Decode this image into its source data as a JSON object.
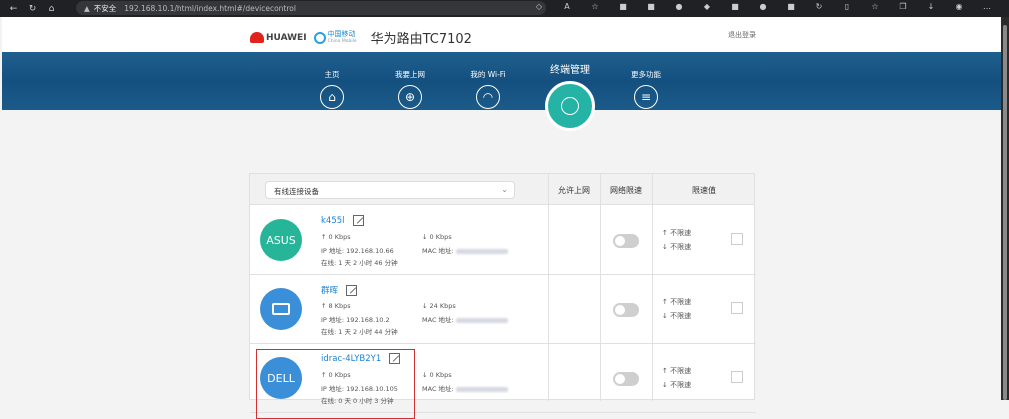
{
  "browser": {
    "security_label": "不安全",
    "url": "192.168.10.1/html/index.html#/devicecontrol"
  },
  "header": {
    "brand_huawei": "HUAWEI",
    "brand_cm": "中国移动",
    "brand_cm_en": "China Mobile",
    "title": "华为路由TC7102",
    "logout": "退出登录"
  },
  "nav": {
    "items": [
      {
        "label": "主页",
        "icon": "home-icon"
      },
      {
        "label": "我要上网",
        "icon": "globe-icon"
      },
      {
        "label": "我的 Wi-Fi",
        "icon": "wifi-icon"
      },
      {
        "label": "终端管理",
        "icon": "user-icon"
      },
      {
        "label": "更多功能",
        "icon": "menu-icon"
      }
    ]
  },
  "table": {
    "filter_value": "有线连接设备",
    "columns": {
      "allow": "允许上网",
      "limit": "网络限速",
      "limit_value": "限速值"
    },
    "ip_prefix": "IP 地址: ",
    "mac_prefix": "MAC 地址: ",
    "online_prefix": "在线: ",
    "unlimited": "不限速",
    "rows": [
      {
        "avatar_text": "ASUS",
        "avatar_color": "#27b59a",
        "name": "k455l",
        "up": "0 Kbps",
        "down": "0 Kbps",
        "ip": "192.168.10.66",
        "online": "1 天 2 小时 46 分钟",
        "up_limit": "不限速",
        "down_limit": "不限速"
      },
      {
        "avatar_text": "",
        "avatar_color": "#3b8fd8",
        "name": "群晖",
        "up": "8 Kbps",
        "down": "24 Kbps",
        "ip": "192.168.10.2",
        "online": "1 天 2 小时 44 分钟",
        "up_limit": "不限速",
        "down_limit": "不限速"
      },
      {
        "avatar_text": "DELL",
        "avatar_color": "#3b8fd8",
        "name": "idrac-4LYB2Y1",
        "up": "0 Kbps",
        "down": "0 Kbps",
        "ip": "192.168.10.105",
        "online": "0 天 0 小时 3 分钟",
        "up_limit": "不限速",
        "down_limit": "不限速"
      }
    ]
  },
  "colors": {
    "banner": "#1b5b89",
    "active": "#25b3a5",
    "link": "#1a82d3",
    "highlight": "#d03030"
  }
}
